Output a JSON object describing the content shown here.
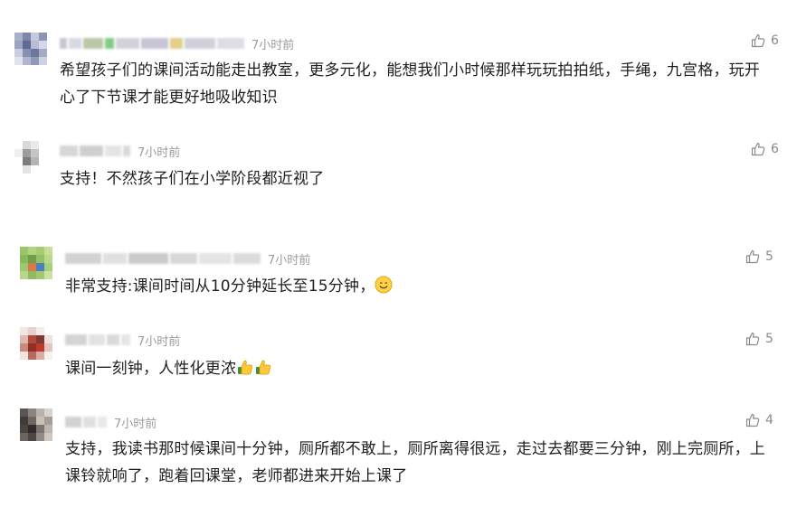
{
  "comments": [
    {
      "time": "7小时前",
      "likes": "6",
      "text": "希望孩子们的课间活动能走出教室，更多元化，能想我们小时候那样玩玩拍拍纸，手绳，九宫格，玩开心了下节课才能更好地吸收知识"
    },
    {
      "time": "7小时前",
      "likes": "6",
      "text": "支持！不然孩子们在小学阶段都近视了"
    },
    {
      "time": "7小时前",
      "likes": "5",
      "text": "非常支持:课间时间从10分钟延长至15分钟，",
      "emoji": "smiling-face-emoji"
    },
    {
      "time": "7小时前",
      "likes": "5",
      "text": "课间一刻钟，人性化更浓",
      "emoji": "thumbs-up-emoji"
    },
    {
      "time": "7小时前",
      "likes": "4",
      "text": "支持，我读书那时候课间十分钟，厕所都不敢上，厕所离得很远，走过去都要三分钟，刚上完厕所，上课铃就响了，跑着回课堂，老师都进来开始上课了"
    }
  ],
  "colors": {
    "time": "#9b9b9b",
    "text": "#1f1f1f",
    "likes": "#8a8a8a"
  }
}
